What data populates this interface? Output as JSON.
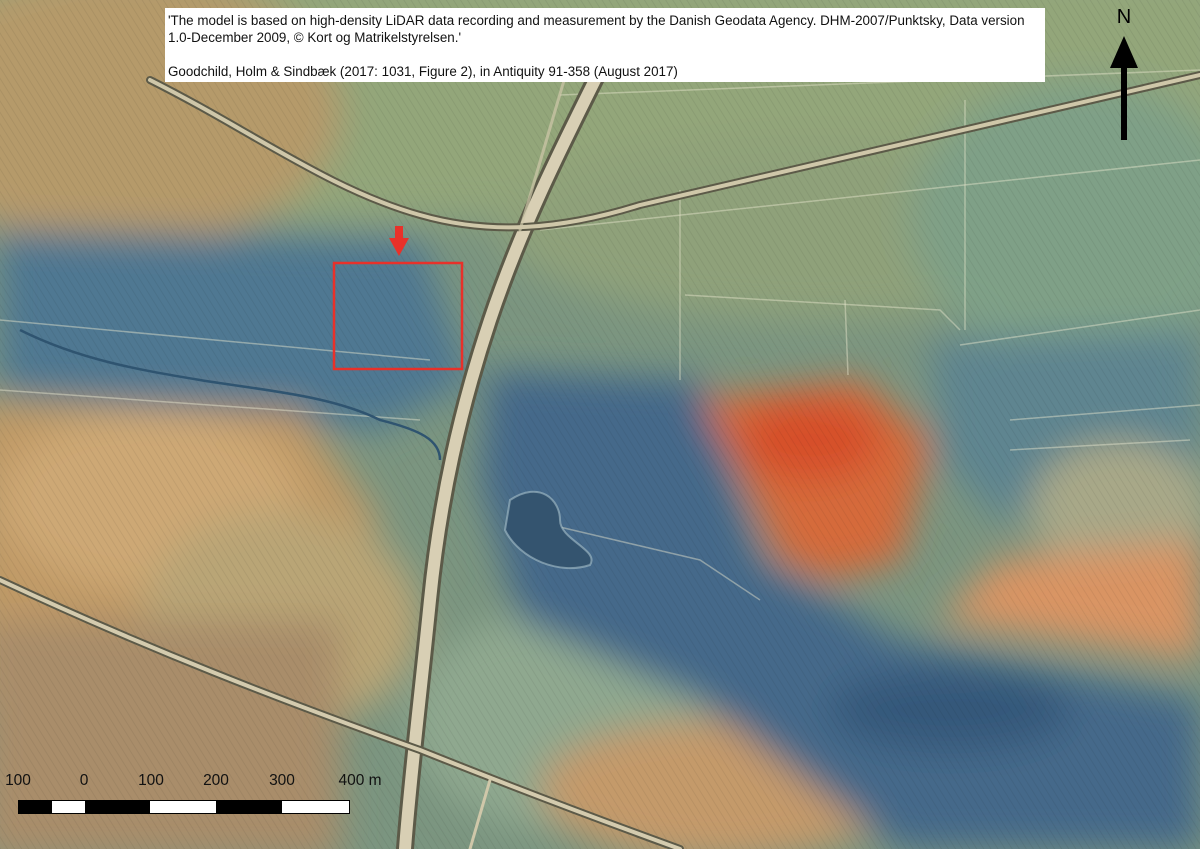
{
  "credits": {
    "line1": "'The model is based on high-density LiDAR data recording and measurement by the Danish Geodata Agency. DHM-2007/Punktsky, Data version 1.0-December 2009, © Kort og Matrikelstyrelsen.'",
    "line2": "Goodchild, Holm & Sindbæk (2017: 1031, Figure 2), in Antiquity 91-358 (August 2017)"
  },
  "north_arrow": {
    "label": "N",
    "icon": "north-arrow-icon"
  },
  "scale_bar": {
    "labels": [
      "100",
      "0",
      "100",
      "200",
      "300",
      "400 m"
    ],
    "unit": "m"
  },
  "highlight": {
    "marker_icon": "red-down-arrow-icon",
    "color": "#e8312a"
  },
  "colors": {
    "lowland": "#3f6786",
    "midland": "#7f9a78",
    "upland": "#d99a5a",
    "highpeak": "#d5512a",
    "road": "#d8cfb4"
  }
}
